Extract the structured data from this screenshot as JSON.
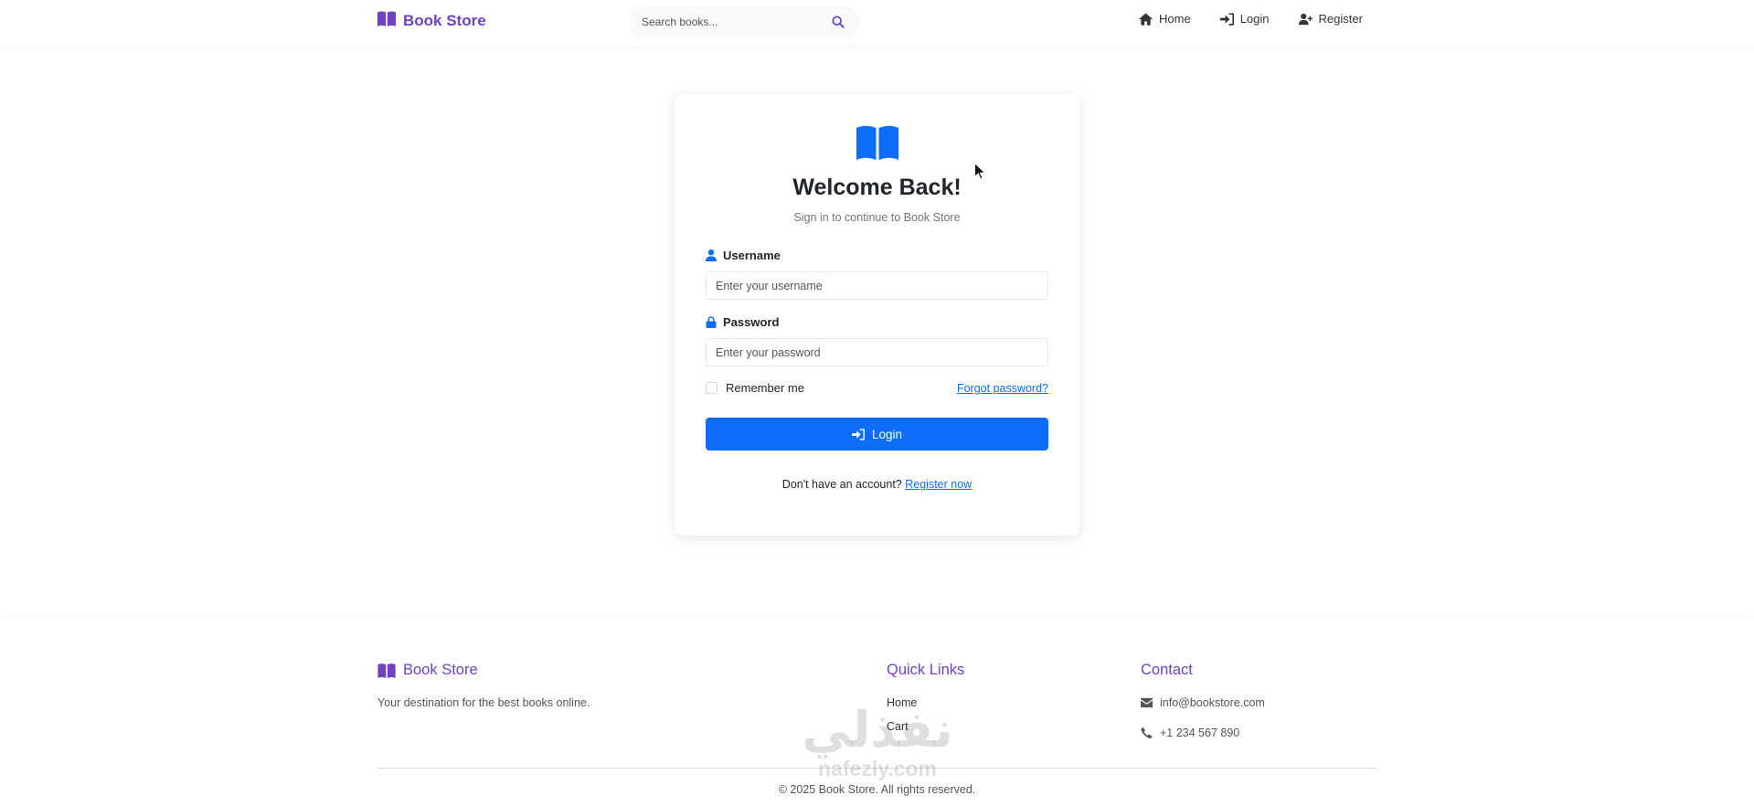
{
  "navbar": {
    "brand": "Book Store",
    "search_placeholder": "Search books...",
    "links": [
      "Home",
      "Login",
      "Register"
    ]
  },
  "login": {
    "title": "Welcome Back!",
    "subtitle": "Sign in to continue to Book Store",
    "username_label": "Username",
    "username_placeholder": "Enter your username",
    "password_label": "Password",
    "password_placeholder": "Enter your password",
    "remember_label": "Remember me",
    "forgot_link": "Forgot password?",
    "login_button": "Login",
    "no_account_text": "Don't have an account?",
    "register_link": "Register now"
  },
  "footer": {
    "brand": "Book Store",
    "tagline": "Your destination for the best books online.",
    "quick_links_heading": "Quick Links",
    "quick_links": [
      "Home",
      "Cart"
    ],
    "contact_heading": "Contact",
    "email": "info@bookstore.com",
    "phone": "+1 234 567 890",
    "copyright": "© 2025 Book Store. All rights reserved."
  },
  "watermark": {
    "arabic": "نفذلي",
    "latin": "nafezly.com"
  },
  "colors": {
    "brand_purple": "#6f42c1",
    "primary_blue": "#0d6efd"
  },
  "icons": [
    "book-open-icon",
    "search-icon",
    "home-icon",
    "sign-in-icon",
    "user-plus-icon",
    "user-icon",
    "lock-icon",
    "envelope-icon",
    "phone-icon"
  ]
}
